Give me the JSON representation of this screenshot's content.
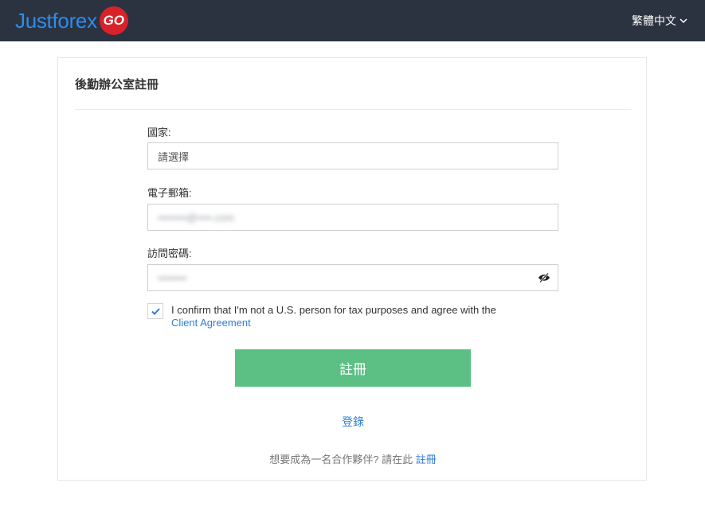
{
  "header": {
    "logo_text": "Justforex",
    "logo_badge": "GO",
    "language": "繁體中文"
  },
  "form": {
    "title": "後勤辦公室註冊",
    "country_label": "國家:",
    "country_value": "請選擇",
    "email_label": "電子郵箱:",
    "email_value": "••••••••@••••.com",
    "password_label": "訪問密碼:",
    "password_value": "••••••••",
    "agree_text": "I confirm that I'm not a U.S. person for tax purposes and agree with the",
    "agree_link": "Client Agreement",
    "agree_checked": true,
    "submit_label": "註冊",
    "login_link": "登錄",
    "partner_text": "想要成為一名合作夥伴? 請在此",
    "partner_link": "註冊"
  },
  "colors": {
    "topbar": "#2b3240",
    "logo_blue": "#2e8de8",
    "badge_red": "#d8222a",
    "submit_green": "#5cc085",
    "link_blue": "#2e7dd8"
  }
}
